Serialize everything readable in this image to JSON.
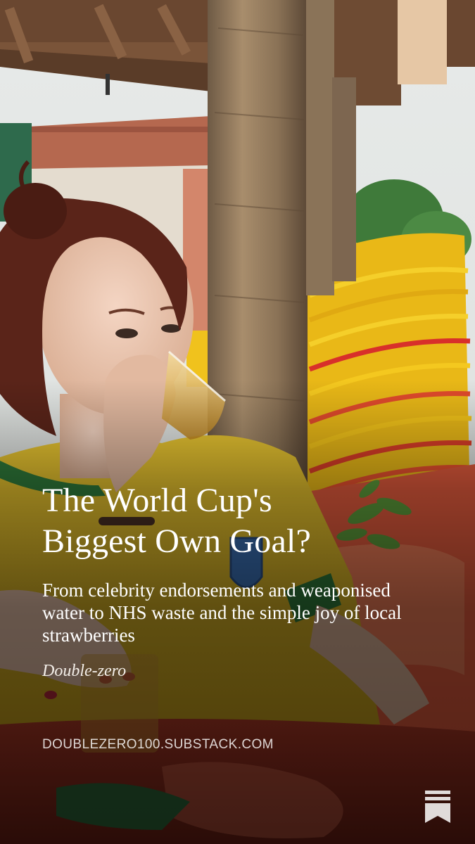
{
  "post": {
    "title_line1": "The World Cup's",
    "title_line2": "Biggest Own Goal?",
    "subtitle": "From celebrity endorsements and weaponised water to NHS waste and the simple joy of local strawberries",
    "publication": "Double-zero",
    "domain": "DOUBLEZERO100.SUBSTACK.COM"
  },
  "icons": {
    "brand_logo": "substack-bookmark-icon"
  },
  "colors": {
    "text": "#ffffff",
    "jersey_yellow": "#e9c624",
    "chair_yellow": "#f2c40e",
    "chair_red": "#e0452a"
  }
}
